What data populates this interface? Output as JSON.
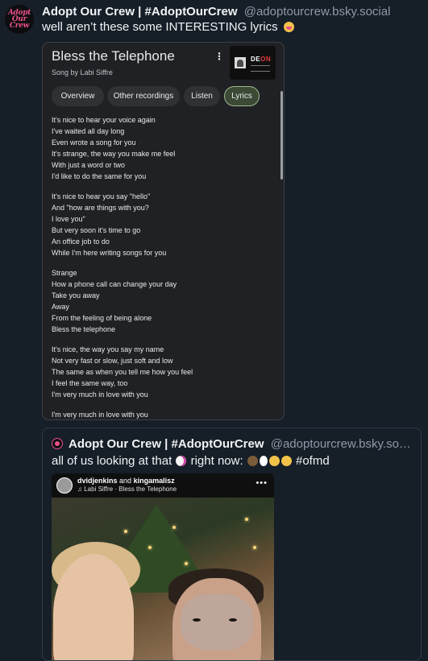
{
  "post": {
    "display_name": "Adopt Our Crew | #AdoptOurCrew",
    "handle": "@adoptourcrew.bsky.social",
    "text": "well aren’t these some INTERESTING lyrics",
    "avatar_text": [
      "Adopt",
      "Our",
      "Crew"
    ]
  },
  "screenshot": {
    "title": "Bless the Telephone",
    "subtitle": "Song by Labi Siffre",
    "tabs": [
      {
        "label": "Overview",
        "active": false
      },
      {
        "label": "Other recordings",
        "active": false
      },
      {
        "label": "Listen",
        "active": false
      },
      {
        "label": "Lyrics",
        "active": true
      }
    ],
    "album_art_word": "DE",
    "album_art_word_red": "ON",
    "lyrics": [
      [
        "It's nice to hear your voice again",
        "I've waited all day long",
        "Even wrote a song for you",
        "It's strange, the way you make me feel",
        "With just a word or two",
        "I'd like to do the same for you"
      ],
      [
        "It's nice to hear you say \"hello\"",
        "And \"how are things with you?",
        "I love you\"",
        "But very soon it's time to go",
        "An office job to do",
        "While I'm here writing songs for you"
      ],
      [
        "Strange",
        "How a phone call can change your day",
        "Take you away",
        "Away",
        "From the feeling of being alone",
        "Bless the telephone"
      ],
      [
        "It's nice, the way you say my name",
        "Not very fast or slow, just soft and low",
        "The same as when you tell me how you feel",
        "I feel the same way, too",
        "I'm very much in love with you"
      ],
      [
        "I'm very much in love with you"
      ]
    ]
  },
  "quote": {
    "display_name": "Adopt Our Crew | #AdoptOurCrew",
    "handle": "@adoptourcrew.bsky.so…",
    "text_before": "all of us looking at that",
    "text_middle": "right now:",
    "hashtag": "#ofmd",
    "story": {
      "user1": "dvidjenkins",
      "joiner": "and",
      "user2": "kingamalisz",
      "song": "♫ Labi Siffre · Bless the Telephone",
      "menu": "•••"
    }
  },
  "colors": {
    "background": "#161e27",
    "accent_pink": "#e8508a",
    "handle_gray": "#8e9bab"
  }
}
